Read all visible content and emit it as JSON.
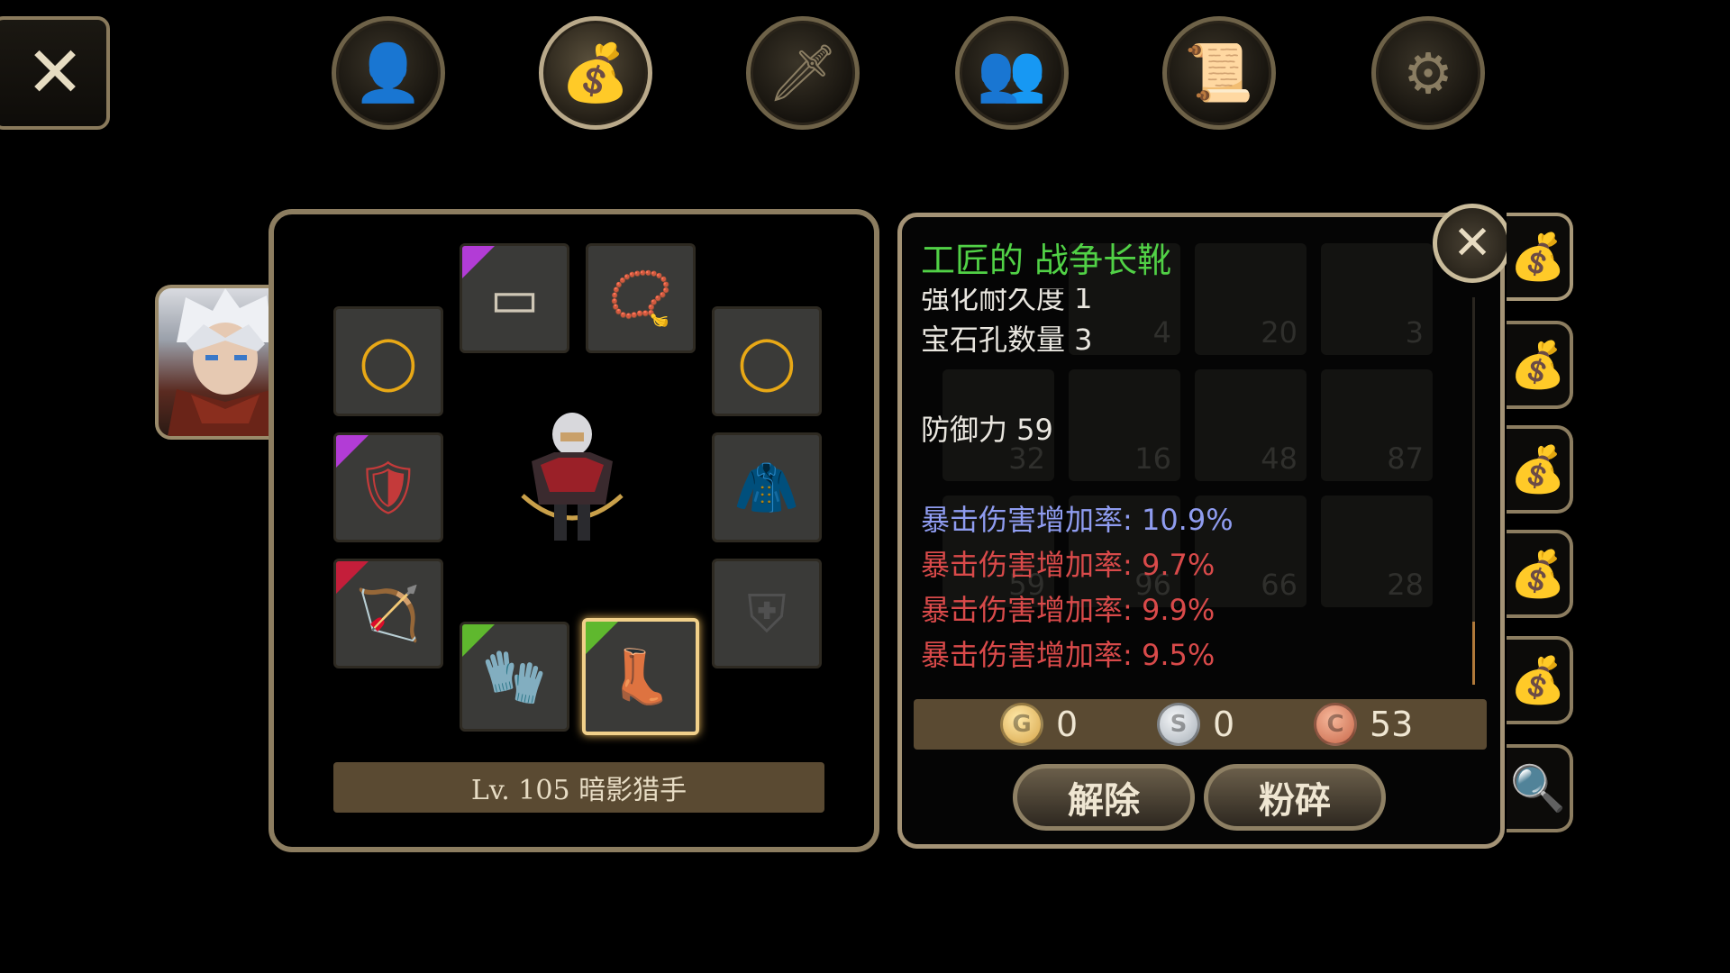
{
  "top_tabs": [
    {
      "name": "character",
      "icon": "head-icon",
      "glyph": "👤",
      "active": false
    },
    {
      "name": "inventory",
      "icon": "bag-icon",
      "glyph": "💰",
      "active": true
    },
    {
      "name": "skills",
      "icon": "sword-compass-icon",
      "glyph": "🗡",
      "active": false
    },
    {
      "name": "party",
      "icon": "group-icon",
      "glyph": "👥",
      "active": false
    },
    {
      "name": "quest",
      "icon": "scroll-question-icon",
      "glyph": "📜",
      "active": false
    },
    {
      "name": "settings",
      "icon": "gear-icon",
      "glyph": "⚙",
      "active": false
    }
  ],
  "close_glyph": "✕",
  "character": {
    "level_text": "Lv. 105 暗影猎手"
  },
  "equipment_slots": [
    {
      "slot": "helmet",
      "icon": "headband-icon",
      "glyph": "▭",
      "rarity_color": "#b23cd6"
    },
    {
      "slot": "necklace",
      "icon": "necklace-icon",
      "glyph": "📿",
      "rarity_color": ""
    },
    {
      "slot": "ring-left",
      "icon": "ring-icon",
      "glyph": "◯",
      "rarity_color": ""
    },
    {
      "slot": "ring-right",
      "icon": "ring-icon",
      "glyph": "◯",
      "rarity_color": ""
    },
    {
      "slot": "shoulder",
      "icon": "shoulder-armor-icon",
      "glyph": "🛡",
      "rarity_color": "#b23cd6"
    },
    {
      "slot": "cloak",
      "icon": "cloak-icon",
      "glyph": "🧥",
      "rarity_color": ""
    },
    {
      "slot": "weapon",
      "icon": "bow-icon",
      "glyph": "🏹",
      "rarity_color": "#c41e3a"
    },
    {
      "slot": "offhand",
      "icon": "shield-empty-icon",
      "glyph": "⛨",
      "rarity_color": ""
    },
    {
      "slot": "gloves",
      "icon": "gauntlet-icon",
      "glyph": "🧤",
      "rarity_color": "#5fb82e"
    },
    {
      "slot": "boots",
      "icon": "boot-icon",
      "glyph": "👢",
      "rarity_color": "#5fb82e",
      "selected": true
    }
  ],
  "item_detail": {
    "name": "工匠的 战争长靴",
    "name_color": "#51d146",
    "partial_line": "强化耐久度 1",
    "socket_line": "宝石孔数量 3",
    "defense_line": "防御力 59",
    "bonus_lines": [
      {
        "text": "暴击伤害增加率: 10.9%",
        "color": "#8f9cf0"
      },
      {
        "text": "暴击伤害增加率: 9.7%",
        "color": "#d94a4a"
      },
      {
        "text": "暴击伤害增加率: 9.9%",
        "color": "#d94a4a"
      },
      {
        "text": "暴击伤害增加率: 9.5%",
        "color": "#d94a4a"
      }
    ]
  },
  "currency": {
    "gold": "0",
    "silver": "0",
    "copper": "53",
    "gold_letter": "G",
    "silver_letter": "S",
    "copper_letter": "C"
  },
  "actions": {
    "unequip_label": "解除",
    "destroy_label": "粉碎"
  },
  "background_grid_counts": [
    "4",
    "20",
    "3",
    "32",
    "16",
    "48",
    "87",
    "59",
    "96",
    "66",
    "28"
  ],
  "bag_tabs": [
    {
      "active": true,
      "glyph": "💰"
    },
    {
      "active": false,
      "glyph": "💰"
    },
    {
      "active": false,
      "glyph": "💰"
    },
    {
      "active": false,
      "glyph": "💰"
    },
    {
      "active": false,
      "glyph": "💰"
    },
    {
      "active": false,
      "glyph": "🔍"
    }
  ],
  "colors": {
    "panel_border": "#8c7d60",
    "bar_fill": "#5a4a32",
    "selected_glow": "#f1d08a"
  }
}
